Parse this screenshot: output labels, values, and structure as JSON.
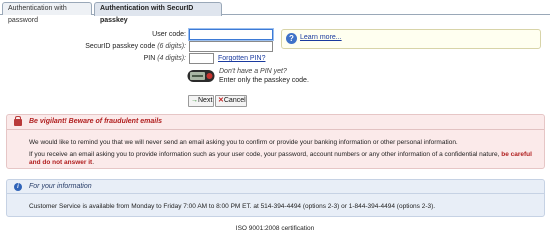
{
  "tabs": [
    {
      "label": "Authentication with password",
      "active": false
    },
    {
      "label": "Authentication with SecurID passkey",
      "active": true
    }
  ],
  "form": {
    "user_code_label": "User code:",
    "passkey_label": "SecurID passkey code",
    "passkey_hint": "(6 digits):",
    "pin_label": "PIN",
    "pin_hint": "(4 digits):",
    "user_code_value": "",
    "passkey_value": "",
    "pin_value": "",
    "forgotten_pin": "Forgotten PIN?",
    "no_pin": "Don't have a PIN yet?",
    "passkey_only": "Enter only the passkey code."
  },
  "learn_more": "Learn more...",
  "buttons": {
    "next_icon": "→",
    "next": "Next",
    "cancel_icon": "✕",
    "cancel": "Cancel"
  },
  "warning": {
    "title": "Be vigilant! Beware of fraudulent emails",
    "p1": "We would like to remind you that we will never send an email asking you to confirm or provide your banking information or other personal information.",
    "p2_plain": "If you receive an email asking you to provide information such as your user code, your password, account numbers or any other information of a confidential nature, ",
    "p2_bold": "be careful and do not answer it",
    "p2_end": "."
  },
  "info": {
    "title": "For your information",
    "text": "Customer Service is available from Monday to Friday 7:00 AM to 8:00 PM ET. at 514-394-4494 (options 2-3) or 1-844-394-4494 (options 2-3)."
  },
  "footer": "ISO 9001:2008 certification",
  "colors": {
    "accent": "#1a3a9e",
    "warning": "#b01e1e",
    "warning_bg": "#fbeaea",
    "info_bg": "#e8eef7"
  }
}
